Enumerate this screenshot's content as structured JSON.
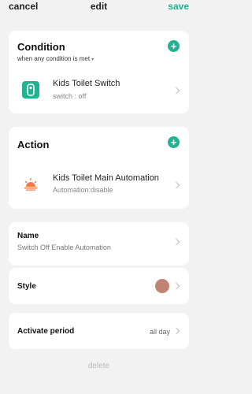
{
  "topbar": {
    "cancel": "cancel",
    "title": "edit",
    "save": "save"
  },
  "condition": {
    "title": "Condition",
    "mode": "when any condition is met",
    "add_icon": "plus-icon",
    "items": [
      {
        "icon": "switch-icon",
        "title": "Kids Toilet Switch",
        "subtitle": "switch : off"
      }
    ]
  },
  "action": {
    "title": "Action",
    "add_icon": "plus-icon",
    "items": [
      {
        "icon": "sunrise-icon",
        "title": "Kids Toilet Main Automation",
        "subtitle": "Automation:disable"
      }
    ]
  },
  "name": {
    "label": "Name",
    "value": "Switch Off Enable Automation"
  },
  "style": {
    "label": "Style",
    "color": "#c08474"
  },
  "period": {
    "label": "Activate period",
    "value": "all day"
  },
  "delete": "delete",
  "colors": {
    "accent": "#22b28f",
    "background": "#f2f2f2",
    "card": "#ffffff"
  }
}
